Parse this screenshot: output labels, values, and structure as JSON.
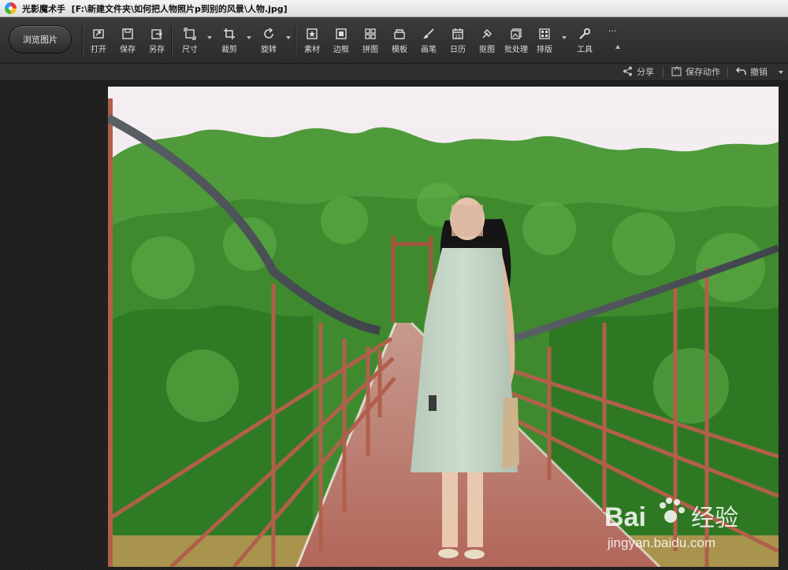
{
  "window": {
    "app_name": "光影魔术手",
    "file_path": "[F:\\新建文件夹\\如何把人物照片p到别的风景\\人物.jpg]"
  },
  "toolbar": {
    "browse_label": "浏览图片",
    "tools": [
      {
        "label": "打开",
        "icon": "open-icon"
      },
      {
        "label": "保存",
        "icon": "save-icon"
      },
      {
        "label": "另存",
        "icon": "save-as-icon"
      },
      {
        "label": "尺寸",
        "icon": "resize-icon"
      },
      {
        "label": "裁剪",
        "icon": "crop-icon"
      },
      {
        "label": "旋转",
        "icon": "rotate-icon"
      },
      {
        "label": "素材",
        "icon": "material-icon"
      },
      {
        "label": "边框",
        "icon": "border-icon"
      },
      {
        "label": "拼图",
        "icon": "collage-icon"
      },
      {
        "label": "模板",
        "icon": "template-icon"
      },
      {
        "label": "画笔",
        "icon": "brush-icon"
      },
      {
        "label": "日历",
        "icon": "calendar-icon"
      },
      {
        "label": "抠图",
        "icon": "cutout-icon"
      },
      {
        "label": "批处理",
        "icon": "batch-icon"
      },
      {
        "label": "排版",
        "icon": "layout-icon"
      },
      {
        "label": "工具",
        "icon": "wrench-icon"
      }
    ],
    "more_label": "···"
  },
  "actionbar": {
    "share_label": "分享",
    "save_action_label": "保存动作",
    "undo_label": "撤销"
  },
  "watermark": {
    "brand": "Bai",
    "brand_cn": "经验",
    "url": "jingyan.baidu.com"
  },
  "colors": {
    "toolbar_bg": "#333333",
    "canvas_bg": "#1e1e1e",
    "text": "#dcdcdc"
  }
}
